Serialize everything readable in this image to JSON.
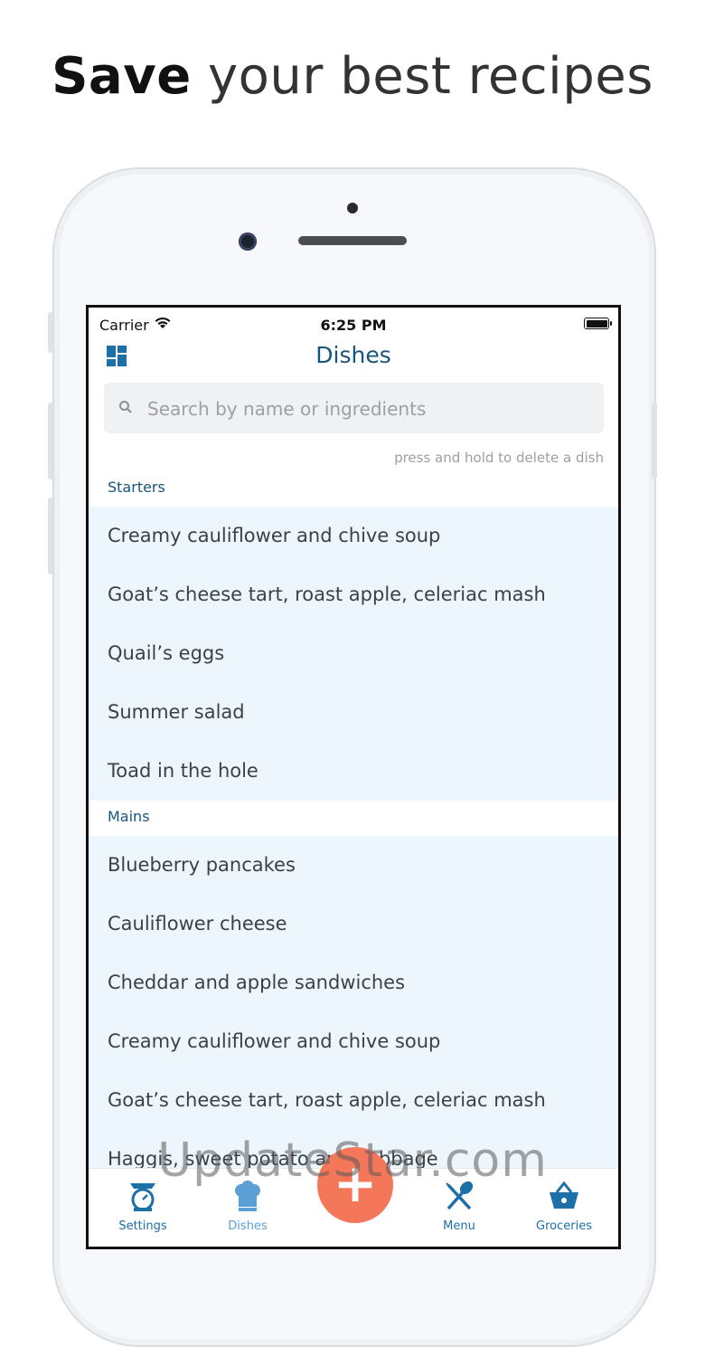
{
  "headline": {
    "bold": "Save",
    "rest": " your best recipes"
  },
  "status_bar": {
    "carrier": "Carrier",
    "time": "6:25 PM"
  },
  "nav": {
    "title": "Dishes"
  },
  "search": {
    "placeholder": "Search by name or ingredients",
    "value": ""
  },
  "hint": "press and hold to delete a dish",
  "sections": [
    {
      "title": "Starters",
      "items": [
        "Creamy cauliflower and chive soup",
        "Goat’s cheese tart, roast apple, celeriac mash",
        "Quail’s eggs",
        "Summer salad",
        "Toad in the hole"
      ]
    },
    {
      "title": "Mains",
      "items": [
        "Blueberry pancakes",
        "Cauliflower cheese",
        "Cheddar and apple sandwiches",
        "Creamy cauliflower and chive soup",
        "Goat’s cheese tart, roast apple, celeriac mash",
        "Haggis, sweet potato and cabbage"
      ]
    }
  ],
  "tabs": {
    "settings": "Settings",
    "dishes": "Dishes",
    "add": "+",
    "menu": "Menu",
    "groceries": "Groceries"
  },
  "colors": {
    "accent": "#18557c",
    "tab_active": "#1d6fa8",
    "tab_inactive": "#5a9fd6",
    "fab": "#f5775a",
    "list_bg": "#eef6fd"
  },
  "watermark": "UpdateStar.com"
}
